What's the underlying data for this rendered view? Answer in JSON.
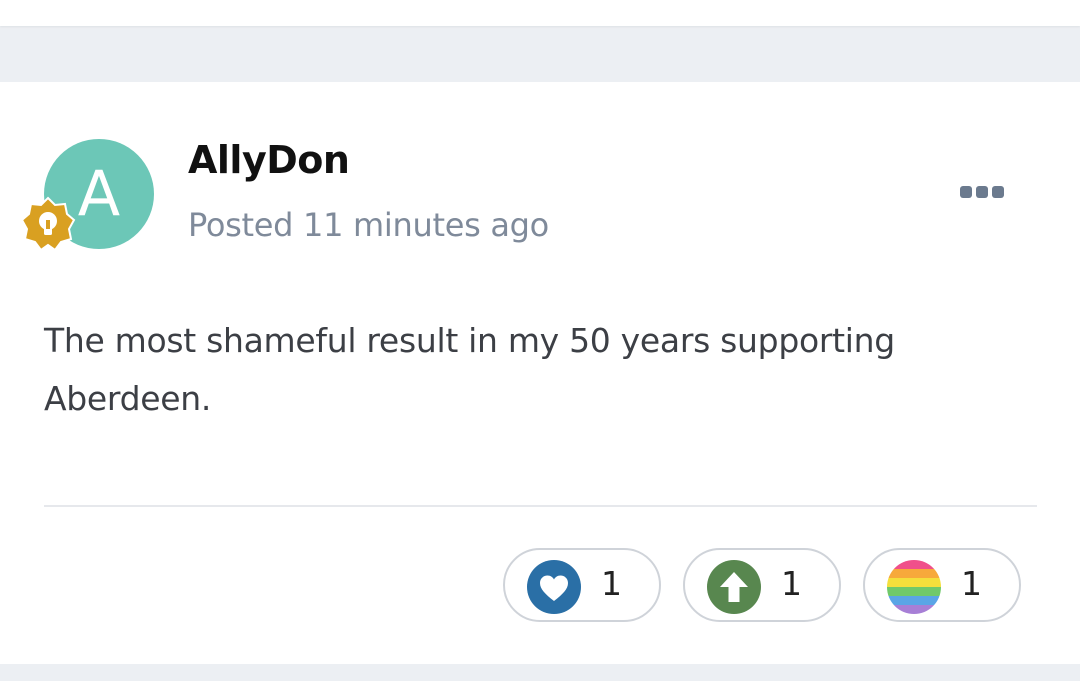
{
  "post": {
    "author": {
      "name": "AllyDon",
      "avatar_letter": "A",
      "avatar_color": "#6cc7b7",
      "badge_icon": "lightbulb-badge-icon",
      "badge_color": "#d9a021"
    },
    "meta": "Posted 11 minutes ago",
    "body": "The most shameful result in my 50 years supporting Aberdeen.",
    "more_icon": "ellipsis-icon"
  },
  "reactions": [
    {
      "name": "like",
      "icon": "heart-icon",
      "color": "#2a6fa6",
      "count": "1"
    },
    {
      "name": "upvote",
      "icon": "up-arrow-icon",
      "color": "#58874f",
      "count": "1"
    },
    {
      "name": "rainbow",
      "icon": "rainbow-icon",
      "color": "multicolor",
      "count": "1"
    }
  ]
}
